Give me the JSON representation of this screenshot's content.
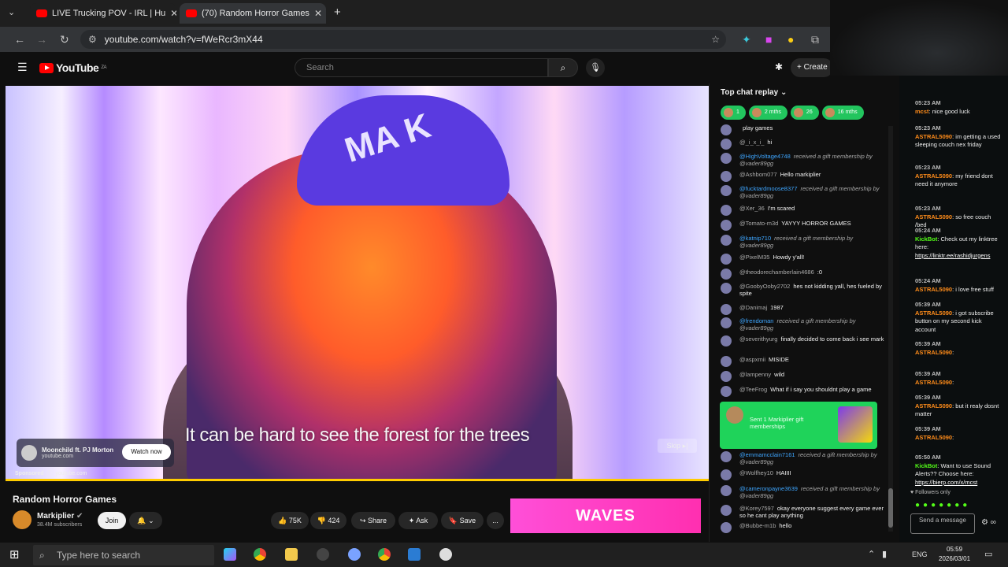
{
  "browser": {
    "tabs": [
      {
        "title": "LIVE Trucking POV - IRL | Hu",
        "active": false
      },
      {
        "title": "(70) Random Horror Games",
        "active": true
      }
    ],
    "new_tab": "+",
    "url": "youtube.com/watch?v=fWeRcr3mX44"
  },
  "youtube": {
    "logo": "YouTube",
    "logo_region": "ZA",
    "search_placeholder": "Search",
    "create_label": "Create"
  },
  "video": {
    "caption": "It can be hard to see the forest for the trees",
    "hat_text": "MA K",
    "ad": {
      "title": "Moonchild ft. PJ Morton",
      "domain": "youtube.com",
      "watch_now": "Watch now",
      "skip": "Skip",
      "sponsored": "Sponsored",
      "sponsored_domain": "youtube.com"
    }
  },
  "below": {
    "title": "Random Horror Games",
    "channel": "Markiplier",
    "subscribers": "38.4M subscribers",
    "join": "Join",
    "likes": "75K",
    "dislikes": "424",
    "share": "Share",
    "ask": "Ask",
    "save": "Save",
    "more": "...",
    "banner": "WAVES"
  },
  "ytchat": {
    "header": "Top chat replay",
    "chips": [
      "1",
      "2 mths",
      "26",
      "16 mths"
    ],
    "messages": [
      {
        "user": "",
        "text": "play games"
      },
      {
        "user": "@_i_x_i_",
        "text": "hi"
      },
      {
        "user": "@HighVoltage4748",
        "gift": "received a gift membership by @vader89gg"
      },
      {
        "user": "@Ashbom077",
        "text": "Hello markiplier"
      },
      {
        "user": "@fucktardmoose8377",
        "gift": "received a gift membership by @vader89gg"
      },
      {
        "user": "@Xer_36",
        "text": "I'm scared"
      },
      {
        "user": "@Tomato-m3d",
        "text": "YAYYY HORROR GAMES"
      },
      {
        "user": "@katnip710",
        "gift": "received a gift membership by @vader89gg"
      },
      {
        "user": "@PixelM35",
        "text": "Howdy y'all!"
      },
      {
        "user": "@theodorechamberlain4686",
        "text": ":0"
      },
      {
        "user": "@GoobyOoby2702",
        "text": "hes not kidding yall, hes fueled by spite"
      },
      {
        "user": "@Danimaj",
        "text": "1987"
      },
      {
        "user": "@frendoman",
        "gift": "received a gift membership by @vader89gg"
      },
      {
        "user": "@severithyurg",
        "text": "finally decided to come back i see mark"
      },
      {
        "user": "@aspxmii",
        "text": "MISIDE"
      },
      {
        "user": "@lampenny",
        "text": "wild"
      },
      {
        "user": "@TeeFrog",
        "text": "What if i say you shouldnt play a game"
      },
      {
        "user": "@emmamcclain7161",
        "gift": "received a gift membership by @vader89gg"
      },
      {
        "user": "@Wolfhey10",
        "text": "HAIIII"
      },
      {
        "user": "@cameronpayne3639",
        "gift": "received a gift membership by @vader89gg"
      },
      {
        "user": "@Korey7597",
        "text": "okay everyone suggest every game ever so he cant play anything"
      },
      {
        "user": "@Bubbe-m1b",
        "text": "hello"
      }
    ],
    "gift_card_text": "Sent 1 Markiplier gift memberships"
  },
  "kick": {
    "messages": [
      {
        "time": "05:23 AM",
        "user": "mcst",
        "text": "nice good luck"
      },
      {
        "time": "05:23 AM",
        "user": "ASTRAL5090",
        "text": "im getting a used sleeping couch nex friday"
      },
      {
        "time": "05:23 AM",
        "user": "ASTRAL5090",
        "text": "my friend dont need it anymore"
      },
      {
        "time": "05:23 AM",
        "user": "ASTRAL5090",
        "text": "so free couch /bed"
      },
      {
        "time": "05:24 AM",
        "user": "KickBot",
        "text": "Check out my linktree here:",
        "link": "https://linktr.ee/rashidjurgens"
      },
      {
        "time": "05:24 AM",
        "user": "ASTRAL5090",
        "text": "i love free stuff"
      },
      {
        "time": "05:39 AM",
        "user": "ASTRAL5090",
        "text": "i got subscribe button on my second kick account"
      },
      {
        "time": "05:39 AM",
        "user": "ASTRAL5090",
        "text": ""
      },
      {
        "time": "05:39 AM",
        "user": "ASTRAL5090",
        "text": ""
      },
      {
        "time": "05:39 AM",
        "user": "ASTRAL5090",
        "text": "but it realy dosnt matter"
      },
      {
        "time": "05:39 AM",
        "user": "ASTRAL5090",
        "text": ""
      },
      {
        "time": "05:50 AM",
        "user": "KickBot",
        "text": "Want to use Sound Alerts?? Choose here:",
        "link": "https://bierp.com/x/mcst"
      }
    ],
    "followers_only": "Followers only",
    "send_placeholder": "Send a message"
  },
  "taskbar": {
    "search_placeholder": "Type here to search",
    "language": "ENG",
    "time": "05:59",
    "date": "2026/03/01"
  },
  "colors": {
    "accent_red": "#ff0000",
    "kick_green": "#53fc18",
    "chip_green": "#22c55e",
    "astral_orange": "#ff8c1a"
  }
}
